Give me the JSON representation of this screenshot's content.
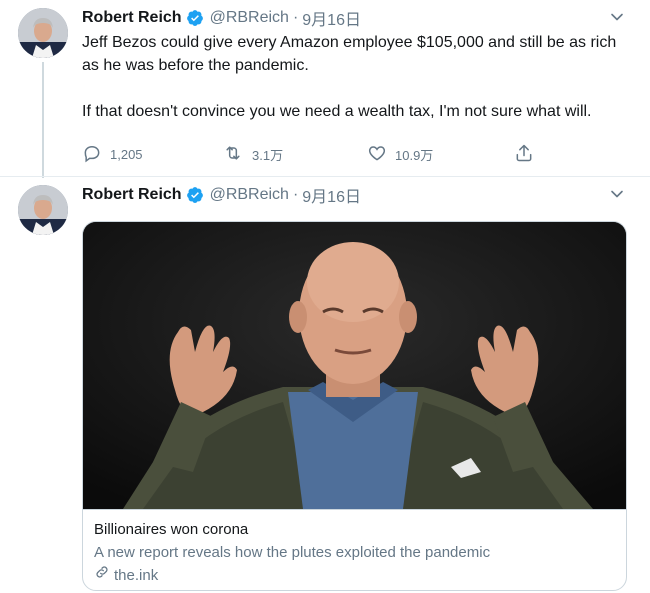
{
  "tweets": [
    {
      "author": "Robert Reich",
      "handle": "@RBReich",
      "separator": "·",
      "date": "9月16日",
      "paragraphs": [
        "Jeff Bezos could give every Amazon employee $105,000 and still be as rich as he was before the pandemic.",
        "If that doesn't convince you we need a wealth tax, I'm not sure what will."
      ],
      "stats": {
        "replies": "1,205",
        "retweets": "3.1万",
        "likes": "10.9万"
      }
    },
    {
      "author": "Robert Reich",
      "handle": "@RBReich",
      "separator": "·",
      "date": "9月16日",
      "card": {
        "title": "Billionaires won corona",
        "description": "A new report reveals how the plutes exploited the pandemic",
        "domain": "the.ink"
      }
    }
  ],
  "icons": {
    "verified": "verified-badge-icon",
    "caret": "chevron-down-icon",
    "reply": "reply-icon",
    "retweet": "retweet-icon",
    "like": "heart-icon",
    "share": "share-icon",
    "link": "link-icon"
  },
  "colors": {
    "verified": "#1da1f2",
    "secondary_text": "#657786",
    "primary_text": "#14171a",
    "border": "#ccd6dd"
  }
}
